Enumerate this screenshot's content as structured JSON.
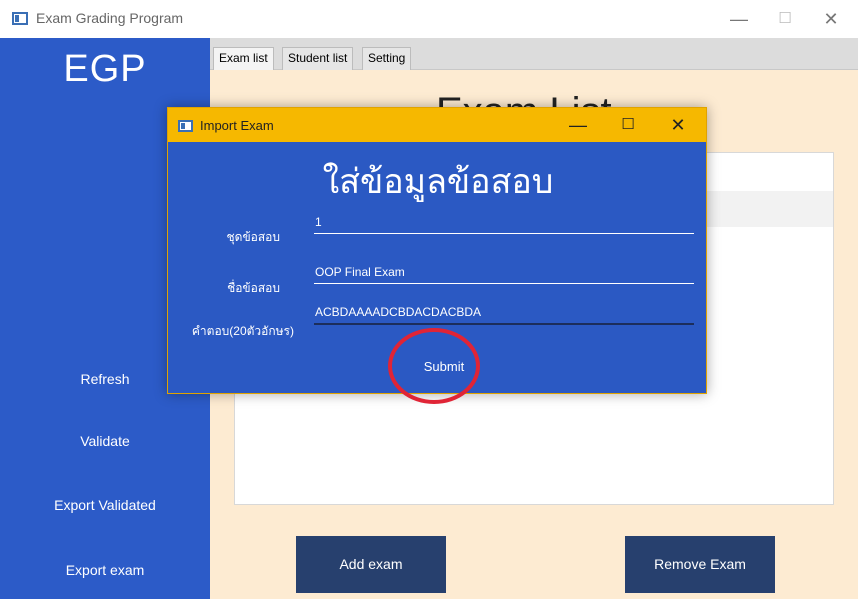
{
  "window": {
    "title": "Exam Grading Program",
    "controls": {
      "minimize": "—",
      "maximize": "☐",
      "close": "✕"
    }
  },
  "sidebar": {
    "brand": "EGP",
    "items": [
      {
        "label": "Refresh"
      },
      {
        "label": "Validate"
      },
      {
        "label": "Export Validated"
      },
      {
        "label": "Export exam"
      }
    ]
  },
  "tabs": [
    {
      "label": "Exam list",
      "active": true
    },
    {
      "label": "Student list",
      "active": false
    },
    {
      "label": "Setting",
      "active": false
    }
  ],
  "main": {
    "heading": "Exam List",
    "add_button": "Add exam",
    "remove_button": "Remove Exam"
  },
  "dialog": {
    "title": "Import Exam",
    "controls": {
      "minimize": "—",
      "maximize": "☐",
      "close": "✕"
    },
    "heading": "ใส่ข้อมูลข้อสอบ",
    "fields": [
      {
        "label": "ชุดข้อสอบ",
        "value": "1"
      },
      {
        "label": "ชื่อข้อสอบ",
        "value": "OOP Final Exam"
      },
      {
        "label": "คำตอบ(20ตัวอักษร)",
        "value": "ACBDAAAADCBDACDACBDA"
      }
    ],
    "submit_label": "Submit"
  },
  "colors": {
    "sidebar": "#2c5bc8",
    "content_bg": "#fdebd2",
    "dialog_bg": "#2b59c3",
    "dialog_titlebar": "#f6b800",
    "action_button": "#27406e",
    "annotation": "#e02436"
  }
}
